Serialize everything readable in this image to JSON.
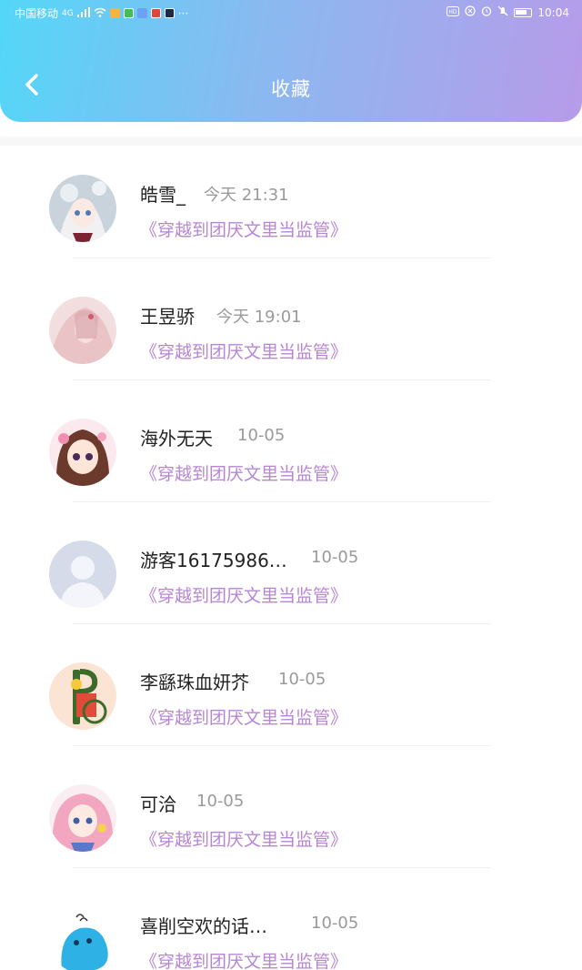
{
  "status_bar": {
    "carrier": "中国移动",
    "signal": "4G",
    "time": "10:04",
    "dots": "···"
  },
  "header": {
    "title": "收藏",
    "back_icon": "chevron-left-icon"
  },
  "favorites": [
    {
      "name": "皓雪_",
      "time": "今天 21:31",
      "book": "《穿越到团厌文里当监管》"
    },
    {
      "name": "王昱骄",
      "time": "今天 19:01",
      "book": "《穿越到团厌文里当监管》"
    },
    {
      "name": "海外无天",
      "time": "10-05",
      "book": "《穿越到团厌文里当监管》"
    },
    {
      "name": "游客16175986…",
      "time": "10-05",
      "book": "《穿越到团厌文里当监管》"
    },
    {
      "name": "李繇珠血妍芥",
      "time": "10-05",
      "book": "《穿越到团厌文里当监管》"
    },
    {
      "name": "可洽",
      "time": "10-05",
      "book": "《穿越到团厌文里当监管》"
    },
    {
      "name": "喜削空欢的话…",
      "time": "10-05",
      "book": "《穿越到团厌文里当监管》"
    }
  ],
  "colors": {
    "header_gradient_start": "#53d7f8",
    "header_gradient_end": "#b79be9",
    "book_link": "#b785d6",
    "time_text": "#9a9a9a"
  }
}
